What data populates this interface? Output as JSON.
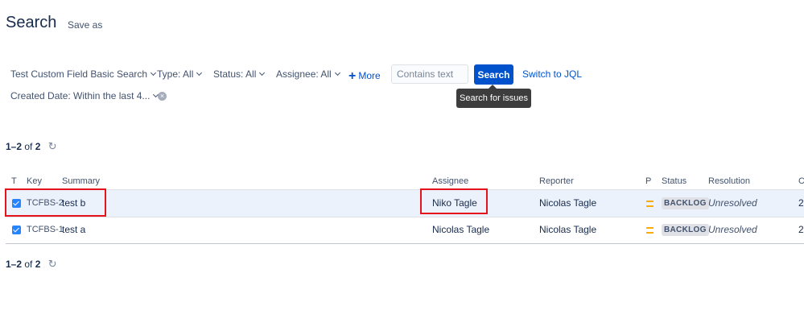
{
  "header": {
    "title": "Search",
    "save_as": "Save as"
  },
  "filters": {
    "project": "Test Custom Field Basic Search",
    "type": "Type: All",
    "status": "Status: All",
    "assignee": "Assignee: All",
    "more": "More",
    "text_placeholder": "Contains text",
    "search_button": "Search",
    "switch_jql": "Switch to JQL",
    "created_date": "Created Date: Within the last 4...",
    "tooltip": "Search for issues"
  },
  "pager": {
    "range": "1–2",
    "of": "of",
    "total": "2"
  },
  "table": {
    "columns": [
      "T",
      "Key",
      "Summary",
      "Assignee",
      "Reporter",
      "P",
      "Status",
      "Resolution",
      "C"
    ],
    "rows": [
      {
        "key": "TCFBS-2",
        "summary": "test b",
        "assignee": "Niko Tagle",
        "reporter": "Nicolas Tagle",
        "status": "BACKLOG",
        "resolution": "Unresolved",
        "created": "2",
        "selected": true
      },
      {
        "key": "TCFBS-1",
        "summary": "test a",
        "assignee": "Nicolas Tagle",
        "reporter": "Nicolas Tagle",
        "status": "BACKLOG",
        "resolution": "Unresolved",
        "created": "2",
        "selected": false
      }
    ]
  },
  "colors": {
    "accent": "#0052cc",
    "highlight": "#e5131b",
    "priority": "#ffab00",
    "selected_row": "#ebf2fb"
  },
  "icons": {
    "refresh": "refresh-icon",
    "task_type": "task-checkbox-icon",
    "priority": "priority-medium-icon",
    "clear": "clear-filter-icon"
  }
}
